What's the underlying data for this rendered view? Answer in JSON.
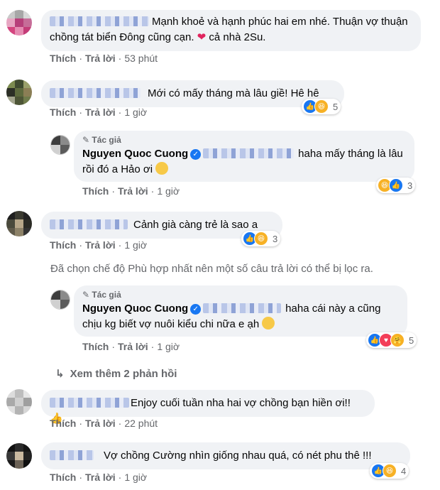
{
  "action_like": "Thích",
  "action_reply": "Trả lời",
  "author_badge": "Tác giả",
  "author_name": "Nguyen Quoc Cuong",
  "notice": "Đã chọn chế độ Phù hợp nhất nên một số câu trả lời có thể bị lọc ra.",
  "see_more": "Xem thêm 2 phản hồi",
  "comments": [
    {
      "text": "Mạnh khoẻ và hạnh phúc hai em nhé. Thuận vợ thuận chồng tát biển Đông cũng cạn.",
      "text_tail": "cả nhà 2Su.",
      "time": "53 phút"
    },
    {
      "text": "Mới có mấy tháng mà lâu giề! Hê hê",
      "time": "1 giờ",
      "reactions": "5"
    },
    {
      "text": "haha mấy tháng là lâu rồi đó a Hảo ơi",
      "time": "1 giờ",
      "reactions": "3"
    },
    {
      "text": "Cảnh già càng trẻ là sao a",
      "time": "1 giờ",
      "reactions": "3"
    },
    {
      "text": "haha cái này a cũng chịu kg biết vợ nuôi kiểu chi nữa e ạh",
      "time": "1 giờ",
      "reactions": "5"
    },
    {
      "text": "Enjoy cuối tuần nha hai vợ chồng bạn hiền ơi!!",
      "time": "22 phút"
    },
    {
      "text": "Vợ chồng Cường nhìn giống nhau quá, có nét phu thê !!!",
      "time": "1 giờ",
      "reactions": "4"
    }
  ],
  "icons": {
    "reply_arrow": "reply-arrow-icon",
    "verified": "verified-badge-icon",
    "pen": "pen-icon"
  },
  "colors": {
    "bubble": "#f0f2f5",
    "secondary_text": "#65676b",
    "like_blue": "#1877f2",
    "love_red": "#f33e58",
    "haha_yellow": "#f7b125"
  }
}
